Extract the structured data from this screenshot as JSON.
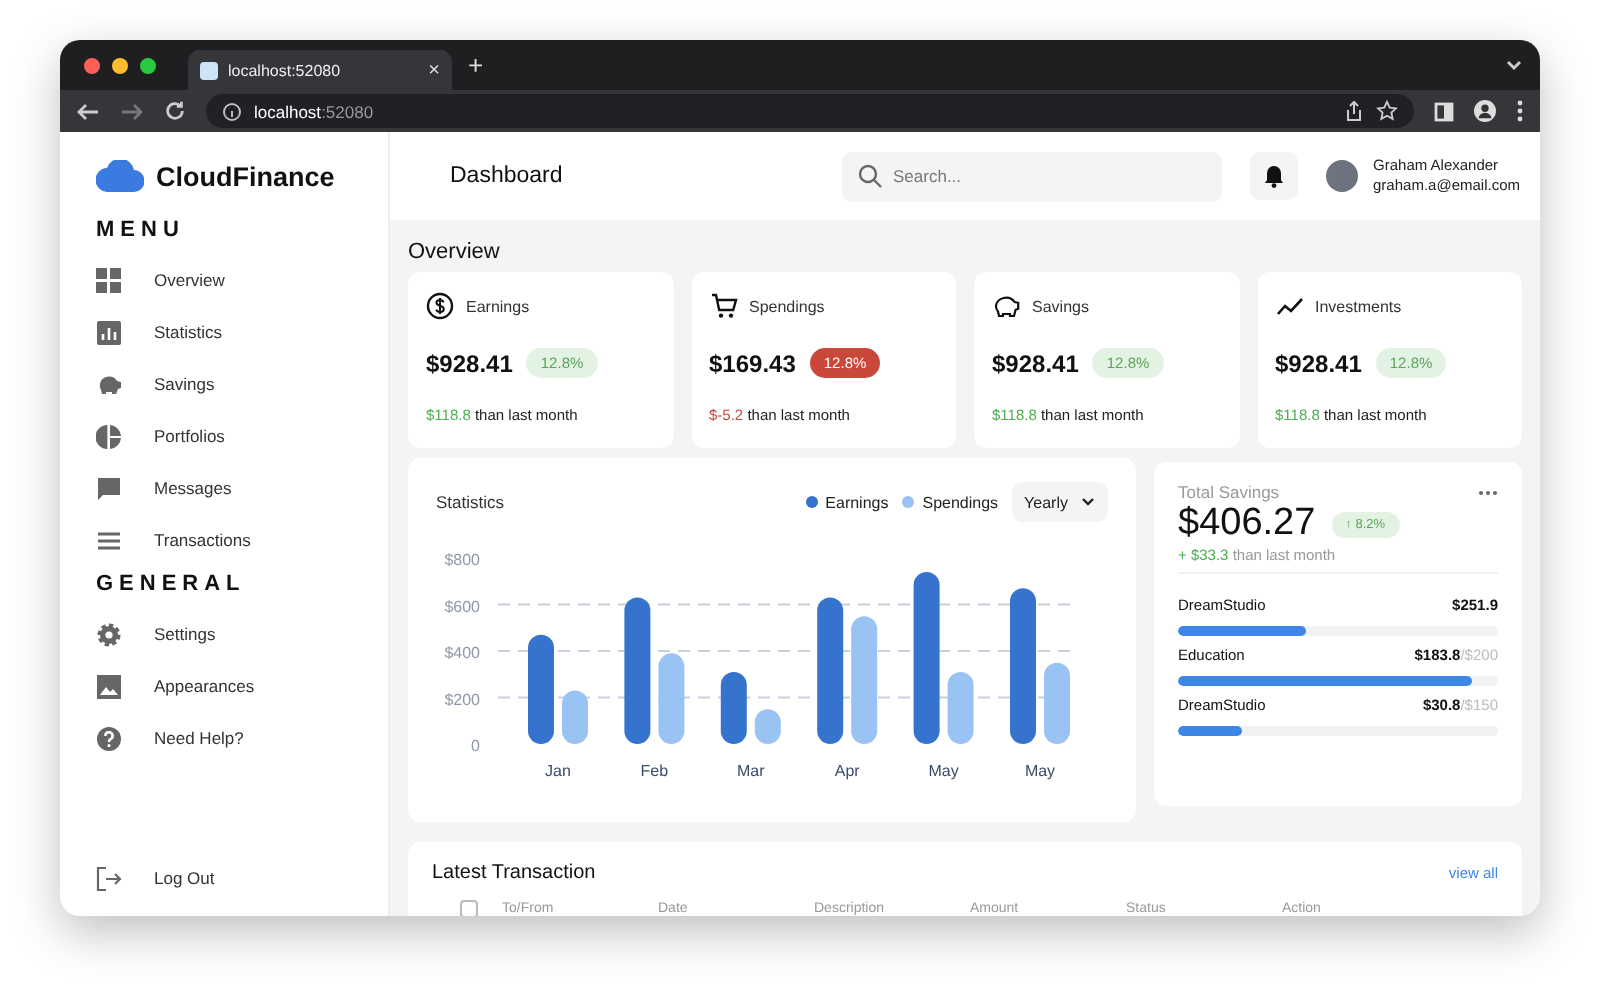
{
  "browser": {
    "tab_title": "localhost:52080",
    "tab_close": "×",
    "new_tab": "+",
    "url_host": "localhost",
    "url_port": ":52080"
  },
  "brand": {
    "name": "CloudFinance"
  },
  "sidebar": {
    "sections": [
      {
        "title": "MENU",
        "items": [
          {
            "label": "Overview",
            "kind": "grid"
          },
          {
            "label": "Statistics",
            "kind": "bars"
          },
          {
            "label": "Savings",
            "kind": "piggy"
          },
          {
            "label": "Portfolios",
            "kind": "pie"
          },
          {
            "label": "Messages",
            "kind": "chat"
          },
          {
            "label": "Transactions",
            "kind": "list"
          }
        ]
      },
      {
        "title": "GENERAL",
        "items": [
          {
            "label": "Settings",
            "kind": "gear"
          },
          {
            "label": "Appearances",
            "kind": "image"
          },
          {
            "label": "Need Help?",
            "kind": "help"
          }
        ]
      }
    ],
    "logout": "Log Out"
  },
  "header": {
    "title": "Dashboard",
    "search": {
      "placeholder": "Search..."
    },
    "user": {
      "name": "Graham Alexander",
      "email": "graham.a@email.com"
    }
  },
  "overview": {
    "title": "Overview",
    "cards": [
      {
        "label": "Earnings",
        "amount": "$928.41",
        "badge": "12.8%",
        "kind": "gain",
        "change": "$118.8",
        "note": "than last month"
      },
      {
        "label": "Spendings",
        "amount": "$169.43",
        "badge": "12.8%",
        "kind": "loss",
        "change": "$-5.2",
        "note": "than last month"
      },
      {
        "label": "Savings",
        "amount": "$928.41",
        "badge": "12.8%",
        "kind": "gain",
        "change": "$118.8",
        "note": "than last month"
      },
      {
        "label": "Investments",
        "amount": "$928.41",
        "badge": "12.8%",
        "kind": "gain",
        "change": "$118.8",
        "note": "than last month"
      }
    ]
  },
  "statistics": {
    "title": "Statistics",
    "period": "Yearly",
    "chart_data": {
      "type": "bar",
      "grid": true,
      "categories": [
        "Jan",
        "Feb",
        "Mar",
        "Apr",
        "May",
        "May"
      ],
      "ylim": [
        0,
        800
      ],
      "yticks": [
        {
          "value": 0,
          "label": "0"
        },
        {
          "value": 200,
          "label": "$200"
        },
        {
          "value": 400,
          "label": "$400"
        },
        {
          "value": 600,
          "label": "$600"
        },
        {
          "value": 800,
          "label": "$800"
        }
      ],
      "series": [
        {
          "name": "Earnings",
          "color": "#3573cf",
          "values": [
            470,
            630,
            310,
            630,
            740,
            670
          ]
        },
        {
          "name": "Spendings",
          "color": "#99c3f3",
          "values": [
            230,
            390,
            150,
            550,
            310,
            350
          ]
        }
      ]
    }
  },
  "total_savings": {
    "title": "Total Savings",
    "amount": "$406.27",
    "badge": "↑ 8.2%",
    "change": "+ $33.3",
    "note": "than last month",
    "goals": [
      {
        "name": "DreamStudio",
        "amount": "$251.9",
        "level": 0.4
      },
      {
        "name": "Education",
        "amount": "$183.8",
        "limit": "/$200",
        "level": 0.92
      },
      {
        "name": "DreamStudio",
        "amount": "$30.8",
        "limit": "/$150",
        "level": 0.2
      }
    ]
  },
  "transactions": {
    "title": "Latest Transaction",
    "link": "view all",
    "select_all_checked": false,
    "columns": [
      "To/From",
      "Date",
      "Description",
      "Amount",
      "Status",
      "Action"
    ]
  }
}
